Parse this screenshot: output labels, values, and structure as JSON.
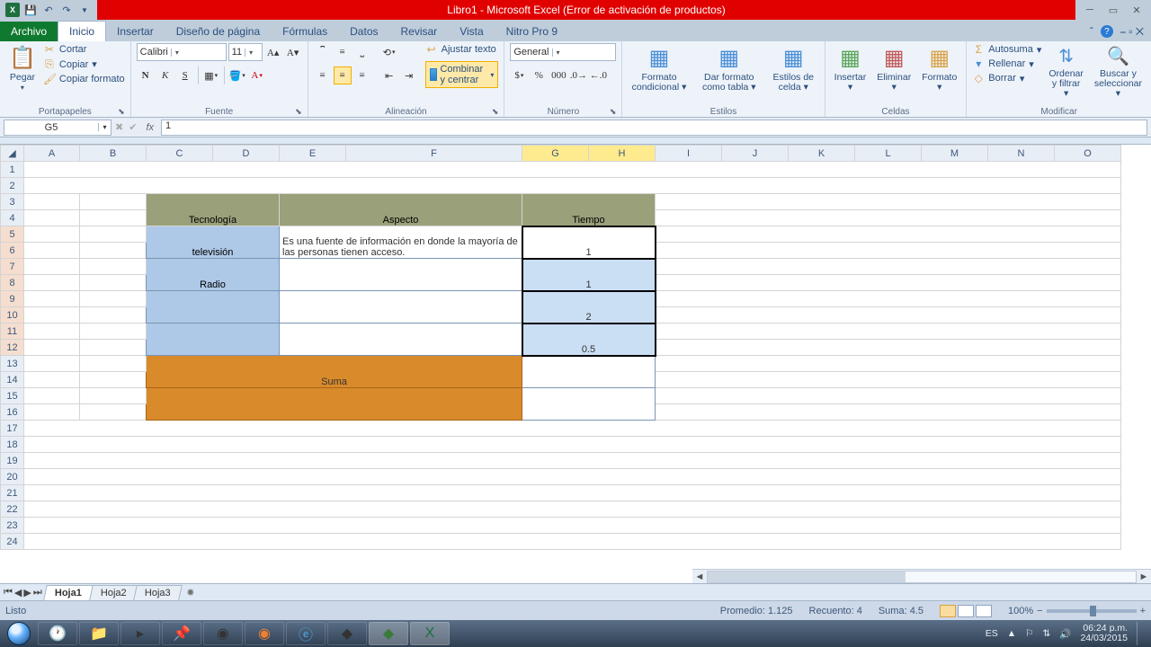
{
  "title": "Libro1  -  Microsoft Excel (Error de activación de productos)",
  "tabs": {
    "file": "Archivo",
    "home": "Inicio",
    "insert": "Insertar",
    "layout": "Diseño de página",
    "formulas": "Fórmulas",
    "data": "Datos",
    "review": "Revisar",
    "view": "Vista",
    "nitro": "Nitro Pro 9"
  },
  "clipboard": {
    "paste": "Pegar",
    "cut": "Cortar",
    "copy": "Copiar",
    "painter": "Copiar formato",
    "label": "Portapapeles"
  },
  "font": {
    "name": "Calibri",
    "size": "11",
    "label": "Fuente",
    "bold": "N",
    "italic": "K",
    "underline": "S"
  },
  "align": {
    "wrap": "Ajustar texto",
    "merge": "Combinar y centrar",
    "label": "Alineación"
  },
  "number": {
    "format": "General",
    "label": "Número"
  },
  "styles": {
    "cond": "Formato condicional",
    "table": "Dar formato como tabla",
    "cell": "Estilos de celda",
    "label": "Estilos"
  },
  "cells": {
    "insert": "Insertar",
    "delete": "Eliminar",
    "format": "Formato",
    "label": "Celdas"
  },
  "editing": {
    "sum": "Autosuma",
    "fill": "Rellenar",
    "clear": "Borrar",
    "sort": "Ordenar y filtrar",
    "find": "Buscar y seleccionar",
    "label": "Modificar"
  },
  "namebox": "G5",
  "formula": "1",
  "cols": [
    "A",
    "B",
    "C",
    "D",
    "E",
    "F",
    "G",
    "H",
    "I",
    "J",
    "K",
    "L",
    "M",
    "N",
    "O"
  ],
  "rows": [
    "1",
    "2",
    "3",
    "4",
    "5",
    "6",
    "7",
    "8",
    "9",
    "10",
    "11",
    "12",
    "13",
    "14",
    "15",
    "16",
    "17",
    "18",
    "19",
    "20",
    "21",
    "22",
    "23",
    "24"
  ],
  "table": {
    "hdr": {
      "tech": "Tecnología",
      "aspect": "Aspecto",
      "time": "Tiempo"
    },
    "r1": {
      "tech": "televisión",
      "aspect": "Es una fuente de información en donde la mayoría de las personas tienen acceso.",
      "time": "1"
    },
    "r2": {
      "tech": "Radio",
      "time": "1"
    },
    "r3": {
      "time": "2"
    },
    "r4": {
      "time": "0.5"
    },
    "sum": "Suma"
  },
  "sheets": {
    "s1": "Hoja1",
    "s2": "Hoja2",
    "s3": "Hoja3"
  },
  "status": {
    "ready": "Listo",
    "avg": "Promedio: 1.125",
    "count": "Recuento: 4",
    "sum": "Suma: 4.5",
    "zoom": "100%"
  },
  "tray": {
    "lang": "ES",
    "time": "06:24 p.m.",
    "date": "24/03/2015"
  }
}
